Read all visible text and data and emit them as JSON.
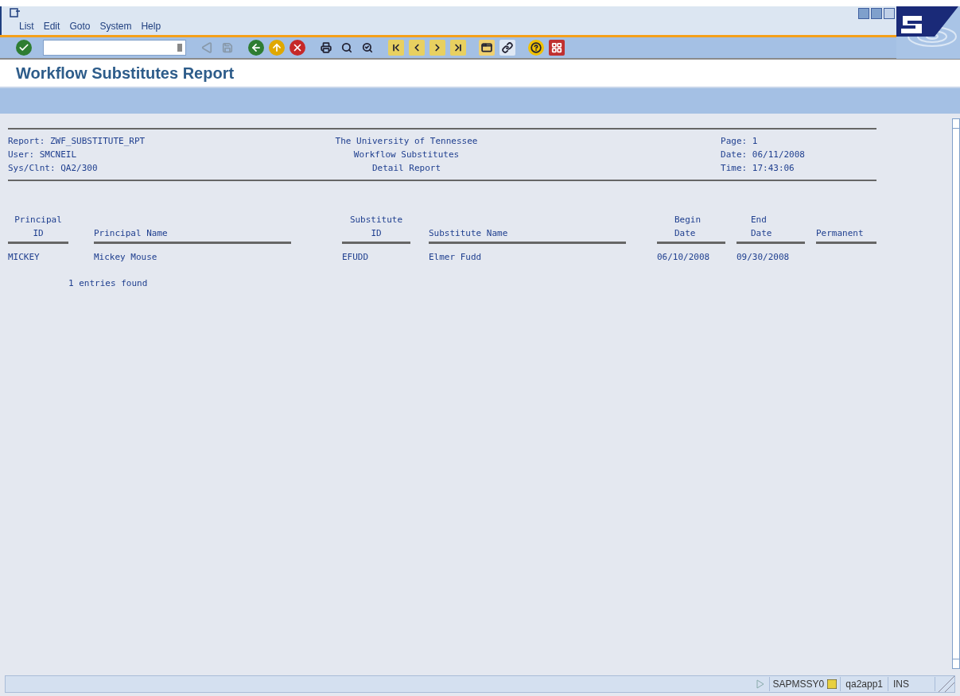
{
  "menu": [
    "List",
    "Edit",
    "Goto",
    "System",
    "Help"
  ],
  "title": "Workflow Substitutes Report",
  "report_header": {
    "left": [
      "Report: ZWF_SUBSTITUTE_RPT",
      "User: SMCNEIL",
      "Sys/Clnt: QA2/300"
    ],
    "center": [
      "The University of Tennessee",
      "Workflow Substitutes",
      "Detail Report"
    ],
    "right": [
      "Page: 1",
      "Date: 06/11/2008",
      "Time: 17:43:06"
    ]
  },
  "table": {
    "columns": [
      "Principal ID",
      "Principal Name",
      "Substitute ID",
      "Substitute Name",
      "Begin Date",
      "End Date",
      "Permanent"
    ],
    "rows": [
      [
        "MICKEY",
        "Mickey Mouse",
        "EFUDD",
        "Elmer Fudd",
        "06/10/2008",
        "09/30/2008"
      ]
    ]
  },
  "footer": "1 entries found",
  "status_bar": {
    "program": "SAPMSSY0",
    "server": "qa2app1",
    "mode": "INS"
  }
}
